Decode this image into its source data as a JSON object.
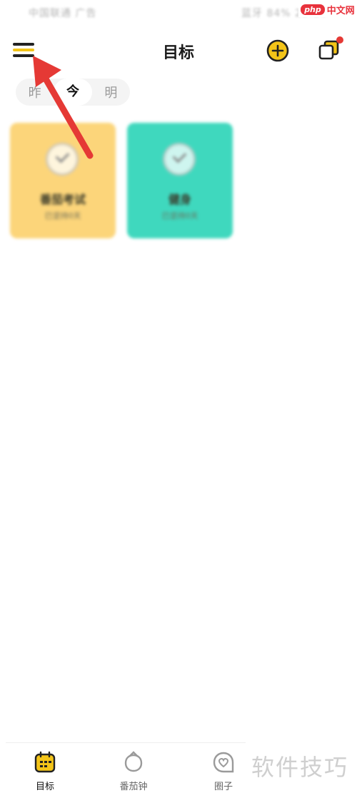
{
  "status_bar": {
    "left_text": "中国联通 广告",
    "right_text": "蓝牙 84% 23:10"
  },
  "watermark": {
    "badge": "php",
    "site": "中文网",
    "bottom_text": "软件技巧"
  },
  "header": {
    "title": "目标"
  },
  "day_tabs": [
    {
      "label": "昨"
    },
    {
      "label": "今"
    },
    {
      "label": "明"
    }
  ],
  "active_day": "今",
  "cards": [
    {
      "title": "番茄考试",
      "subtitle": "已坚持0天",
      "color": "#fcd57a"
    },
    {
      "title": "健身",
      "subtitle": "已坚持0天",
      "color": "#3fd8be"
    }
  ],
  "bottom_nav": [
    {
      "label": "目标",
      "icon": "calendar-icon",
      "active": true
    },
    {
      "label": "番茄钟",
      "icon": "tomato-timer-icon",
      "active": false
    },
    {
      "label": "圈子",
      "icon": "heart-chat-icon",
      "active": false
    }
  ],
  "colors": {
    "accent": "#f3c418",
    "annotation": "#e53935"
  },
  "icons": {
    "menu": "hamburger-menu-icon",
    "add": "plus-circle-icon",
    "stack": "stacked-cards-icon"
  }
}
